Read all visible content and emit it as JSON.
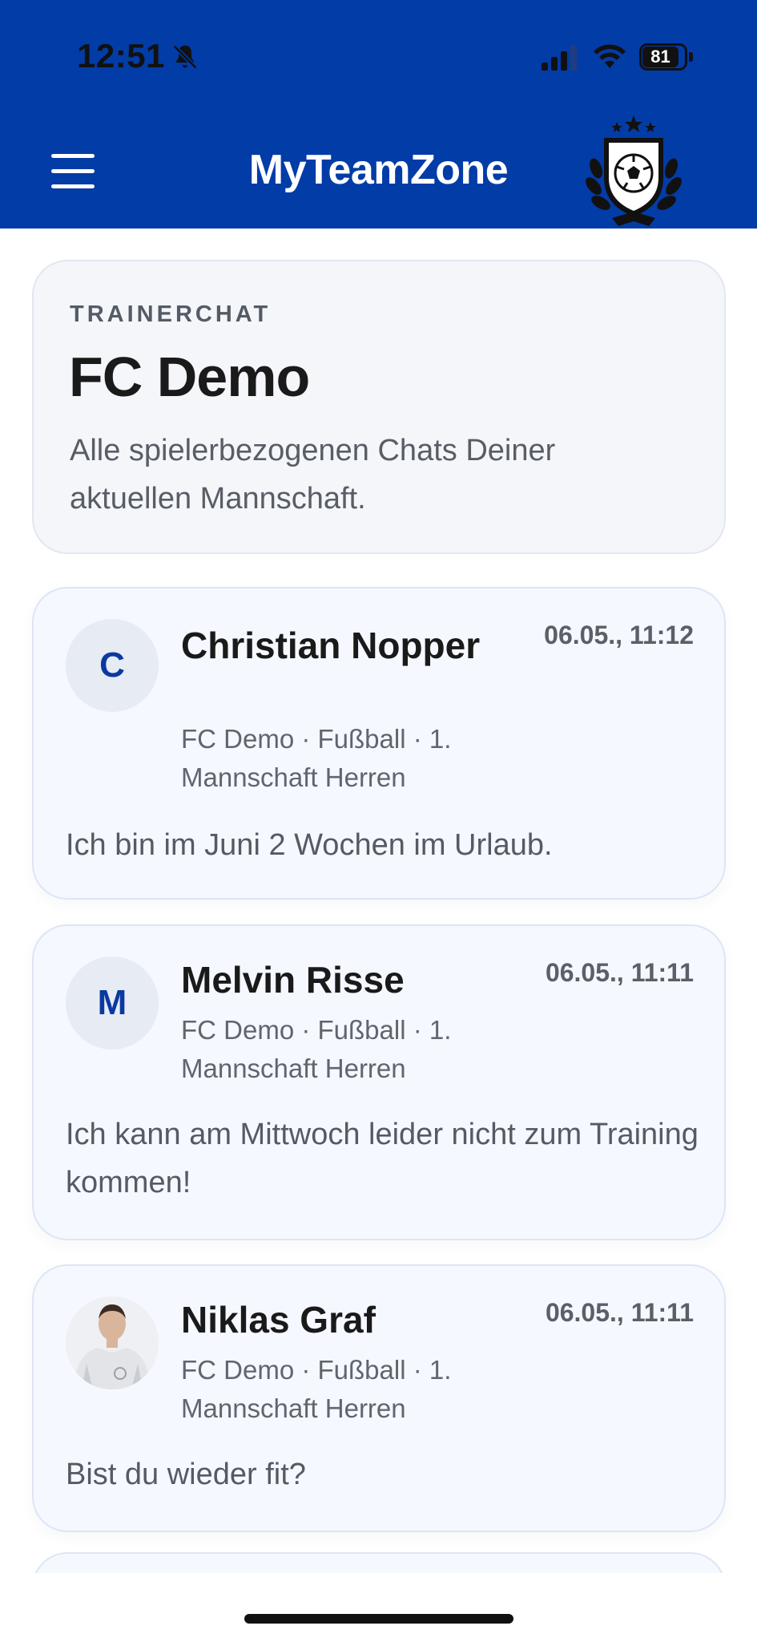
{
  "status_bar": {
    "time": "12:51",
    "battery": "81",
    "icons": [
      "bell-slash-icon",
      "signal-icon",
      "wifi-icon",
      "battery-icon"
    ]
  },
  "header": {
    "app_title": "MyTeamZone",
    "menu_icon": "hamburger-menu-icon",
    "logo": "club-crest-logo",
    "color": "#023ca7"
  },
  "team_card": {
    "eyebrow": "TRAINERCHAT",
    "title": "FC Demo",
    "subtitle": "Alle spielerbezogenen Chats Deiner aktuellen Mannschaft."
  },
  "chats": [
    {
      "initial": "C",
      "name": "Christian Nopper",
      "time": "06.05., 11:12",
      "meta": "FC Demo · Fußball · 1. Mannschaft Herren",
      "message": "Ich bin im Juni 2 Wochen im Urlaub."
    },
    {
      "initial": "M",
      "name": "Melvin Risse",
      "time": "06.05., 11:11",
      "meta": "FC Demo · Fußball · 1. Mannschaft Herren",
      "message": "Ich kann am Mittwoch leider nicht zum Training kommen!"
    },
    {
      "avatar": "player-photo",
      "name": "Niklas Graf",
      "time": "06.05., 11:11",
      "meta": "FC Demo · Fußball · 1. Mannschaft Herren",
      "message": "Bist du wieder fit?"
    }
  ]
}
